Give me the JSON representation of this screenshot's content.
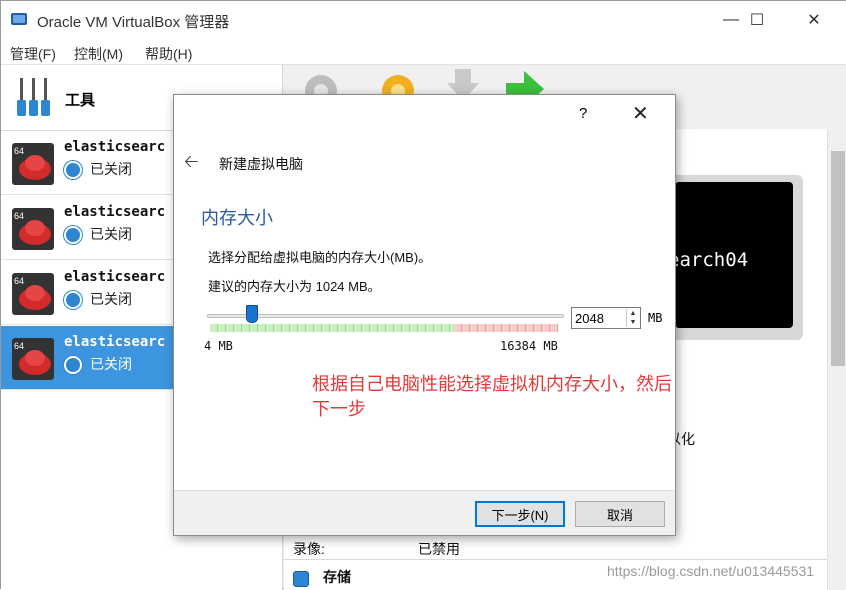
{
  "window": {
    "title": "Oracle VM VirtualBox 管理器",
    "minimize_icon": "minimize-icon",
    "maximize_icon": "maximize-icon",
    "close_icon": "close-icon"
  },
  "menu": [
    "管理(F)",
    "控制(M)",
    "帮助(H)"
  ],
  "sidebar": {
    "tools_label": "工具",
    "vms": [
      {
        "name": "elasticsearc",
        "state": "已关闭",
        "selected": false
      },
      {
        "name": "elasticsearc",
        "state": "已关闭",
        "selected": false
      },
      {
        "name": "elasticsearc",
        "state": "已关闭",
        "selected": false
      },
      {
        "name": "elasticsearc",
        "state": "已关闭",
        "selected": true
      }
    ]
  },
  "right": {
    "preview_text": "earch04",
    "peek_text": "以化",
    "record_label": "录像:",
    "record_value": "已禁用",
    "storage_label": "存储",
    "watermark": "https://blog.csdn.net/u013445531"
  },
  "dialog": {
    "help": "?",
    "close": "✕",
    "heading": "新建虚拟电脑",
    "section_title": "内存大小",
    "description": "选择分配给虚拟电脑的内存大小(MB)。",
    "recommendation": "建议的内存大小为 1024 MB。",
    "memory": {
      "value": "2048",
      "unit": "MB",
      "min_label": "4 MB",
      "max_label": "16384 MB",
      "slider_fraction": 0.125
    },
    "annotation": "根据自己电脑性能选择虚拟机内存大小，然后下一步",
    "next_button": "下一步(N)",
    "cancel_button": "取消"
  },
  "colors": {
    "selection": "#3d95e0",
    "section_title": "#2b5aa3",
    "annotation": "#e03a3a",
    "slider_thumb": "#1a73d1"
  }
}
